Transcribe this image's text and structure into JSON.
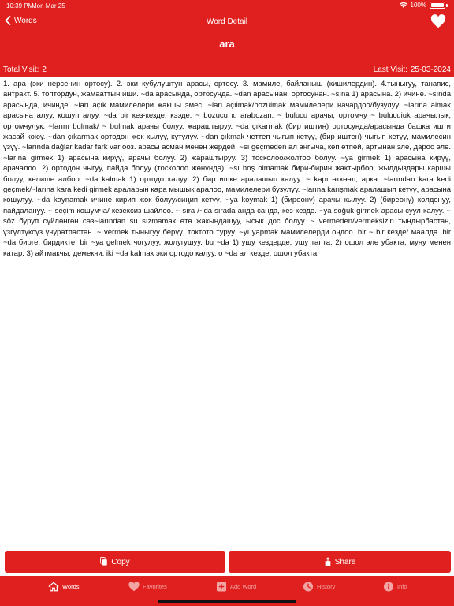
{
  "status_bar": {
    "time": "10:39 PM",
    "date": "Mon Mar 25",
    "battery": "100%"
  },
  "navbar": {
    "back_label": "Words",
    "title": "Word Detail"
  },
  "word": "ara",
  "visits": {
    "total_label": "Total Visit:",
    "total_value": "2",
    "last_label": "Last Visit:",
    "last_value": "25-03-2024"
  },
  "definition": "1. ара (эки нерсенин ортосу). 2. эки кубулуштун арасы, ортосу. 3. мамиле, байланыш (кишилердин). 4.тыныгуу, танапис, антракт. 5. топтордун, жамааттын иши. ~da арасында, ортосунда. ~dan арасынан, ортосунан. ~sına 1) арасына. 2) ичине. ~sında арасында, ичинде. ~ları açık мамилелери жакшы эмес. ~ları açılmak/bozulmak мамилелери начардоо/бузулуу. ~larına almak арасына алуу, кошуп алуу. ~da bir кез-кезде, кээде. ~ bozucu к. arabozan. ~ bulucu арачы, ортомчу ~ bulucuiuk арачылык, ортомчулук. ~larını bulmak/ ~ bulmak арачы болуу, жараштыруу. ~da çıkarmak (бир иштин) ортосунда/арасында башка ишти жасай коюу. ~dan çıkarmak ортодон жок кылуу, кутулуу. ~dan çıkmak четтеп чыгып кетүү, (бир иштен) чыгып кетүү, мамилесин үзүү. ~larında dağlar kadar fark var ооз. арасы асман менен жердей. ~sı geçmeden ал аңгыча, көп өтпөй, артынан эле, дароо эле. ~larına girmek 1) арасына кирүү, арачы болуу. 2) жараштыруу. 3) тосколоо/жолтоо болуу. ~ya girmek 1) арасына кирүү, арачалоо. 2) ортодон чыгуу, пайда болуу (тосколоо жөнүндө). ~sı hoş olmamak бири-бирин жактырбоо, жылдыздары каршы болуу, келише албоо. ~da kalmak 1) ортодо калуу. 2) бир ишке аралашып калуу. ~ kapı өткөөл, арка. ~larından kara kedi geçmek/~larına kara kedi girmek араларын кара мышык аралоо, мамилелери бузулуу. ~larına karışmak аралашып кетүү, арасына кошулуу. ~da kaynamak ичине кирип жок болуу/сиңип кетүү. ~ya koymak 1) (биреөнү) арачы кылуу. 2) (биреөнү) колдонуу, пайдалануу. ~ seçim кошумча/ кезексиз шайлоо. ~ sıra /~da sırada анда-санда, кез-кезде. ~ya soğuk girmek арасы суул калуу. ~ söz буруп сүйлөнгөн сөз~larından su sızmamak өтө жакындашуу, ысык дос болуу. ~ vermeden/vermeksizin тындырбастан, үзгүлтүксүз үчуратпастан. ~ vermek тыныгуу берүү, токтото туруу. ~yı yapmak мамилелерди оңдоо. bir ~ bir кезде/ маалда. bir ~da бирге, бирдикте. bir ~ya gelmek чогулуу, жолугушуу. bu ~da 1) ушу кездерде, ушу тапта. 2) ошол эле убакта, муну менен катар. 3) айтмакчы, демекчи. iki ~da kalmak эки ортодо калуу. o ~da ал кезде, ошол убакта.",
  "actions": {
    "copy_label": "Copy",
    "share_label": "Share"
  },
  "tabs": [
    {
      "label": "Words",
      "icon": "home-icon",
      "active": true
    },
    {
      "label": "Favorites",
      "icon": "heart-icon",
      "active": false
    },
    {
      "label": "Add Word",
      "icon": "plus-icon",
      "active": false
    },
    {
      "label": "History",
      "icon": "clock-icon",
      "active": false
    },
    {
      "label": "Info",
      "icon": "info-icon",
      "active": false
    }
  ],
  "colors": {
    "accent": "#e0201e",
    "inactive_tab": "#f2a3a3"
  }
}
